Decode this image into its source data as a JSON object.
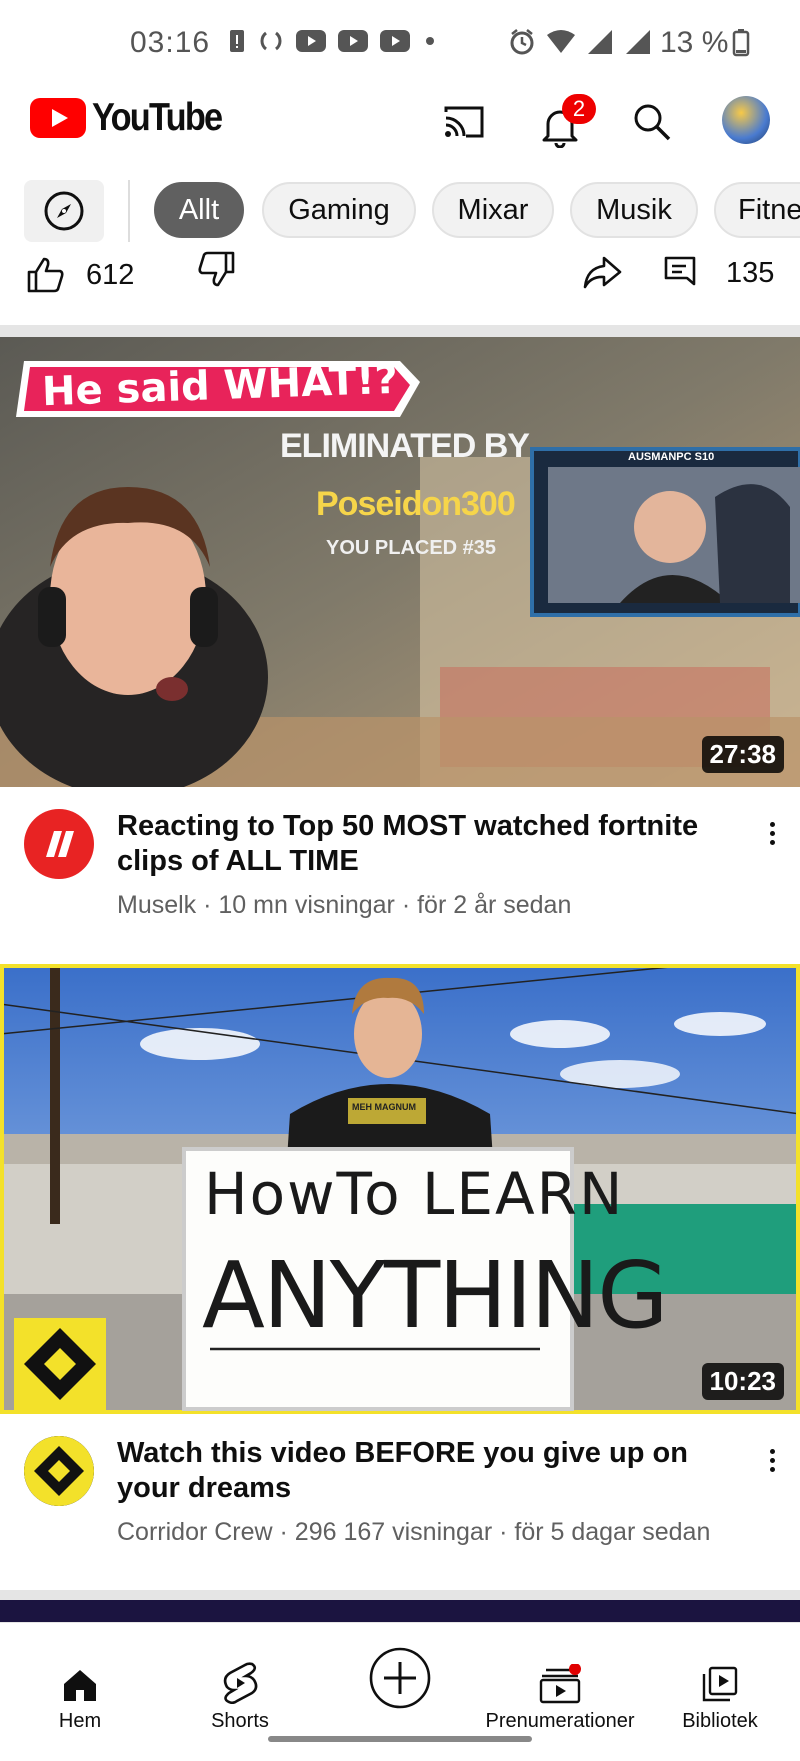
{
  "status_bar": {
    "time": "03:16",
    "battery_text": "13 %"
  },
  "header": {
    "logo_text": "YouTube",
    "notification_count": "2",
    "icons": [
      "cast-icon",
      "bell-icon",
      "search-icon",
      "account-avatar"
    ]
  },
  "chips": [
    "Allt",
    "Gaming",
    "Mixar",
    "Musik",
    "Fitne"
  ],
  "actions": {
    "likes": "612",
    "comments": "135"
  },
  "videos": [
    {
      "thumbnail_text": {
        "banner": "He said WHAT!?",
        "eliminated": "ELIMINATED BY",
        "player": "Poseidon300",
        "placed": "YOU PLACED #35",
        "cam_tag": "AUSMANPC S10"
      },
      "duration": "27:38",
      "title": "Reacting to Top 50 MOST watched fortnite clips of ALL TIME",
      "subtitle": "Muselk · 10 mn visningar · för 2 år sedan"
    },
    {
      "thumbnail_text": {
        "line1": "HowTo LEARN",
        "line2": "ANYTHING",
        "shirt": "MEH MAGNUM"
      },
      "duration": "10:23",
      "title": "Watch this video BEFORE you give up on your dreams",
      "subtitle": "Corridor Crew · 296 167 visningar · för 5 dagar sedan"
    }
  ],
  "nav": [
    {
      "label": "Hem",
      "icon": "home-icon"
    },
    {
      "label": "Shorts",
      "icon": "shorts-icon"
    },
    {
      "label": "",
      "icon": "create-icon"
    },
    {
      "label": "Prenumerationer",
      "icon": "subscriptions-icon"
    },
    {
      "label": "Bibliotek",
      "icon": "library-icon"
    }
  ],
  "colors": {
    "brand_red": "#ff0000",
    "badge_red": "#e00000",
    "chip_active": "#606060"
  }
}
